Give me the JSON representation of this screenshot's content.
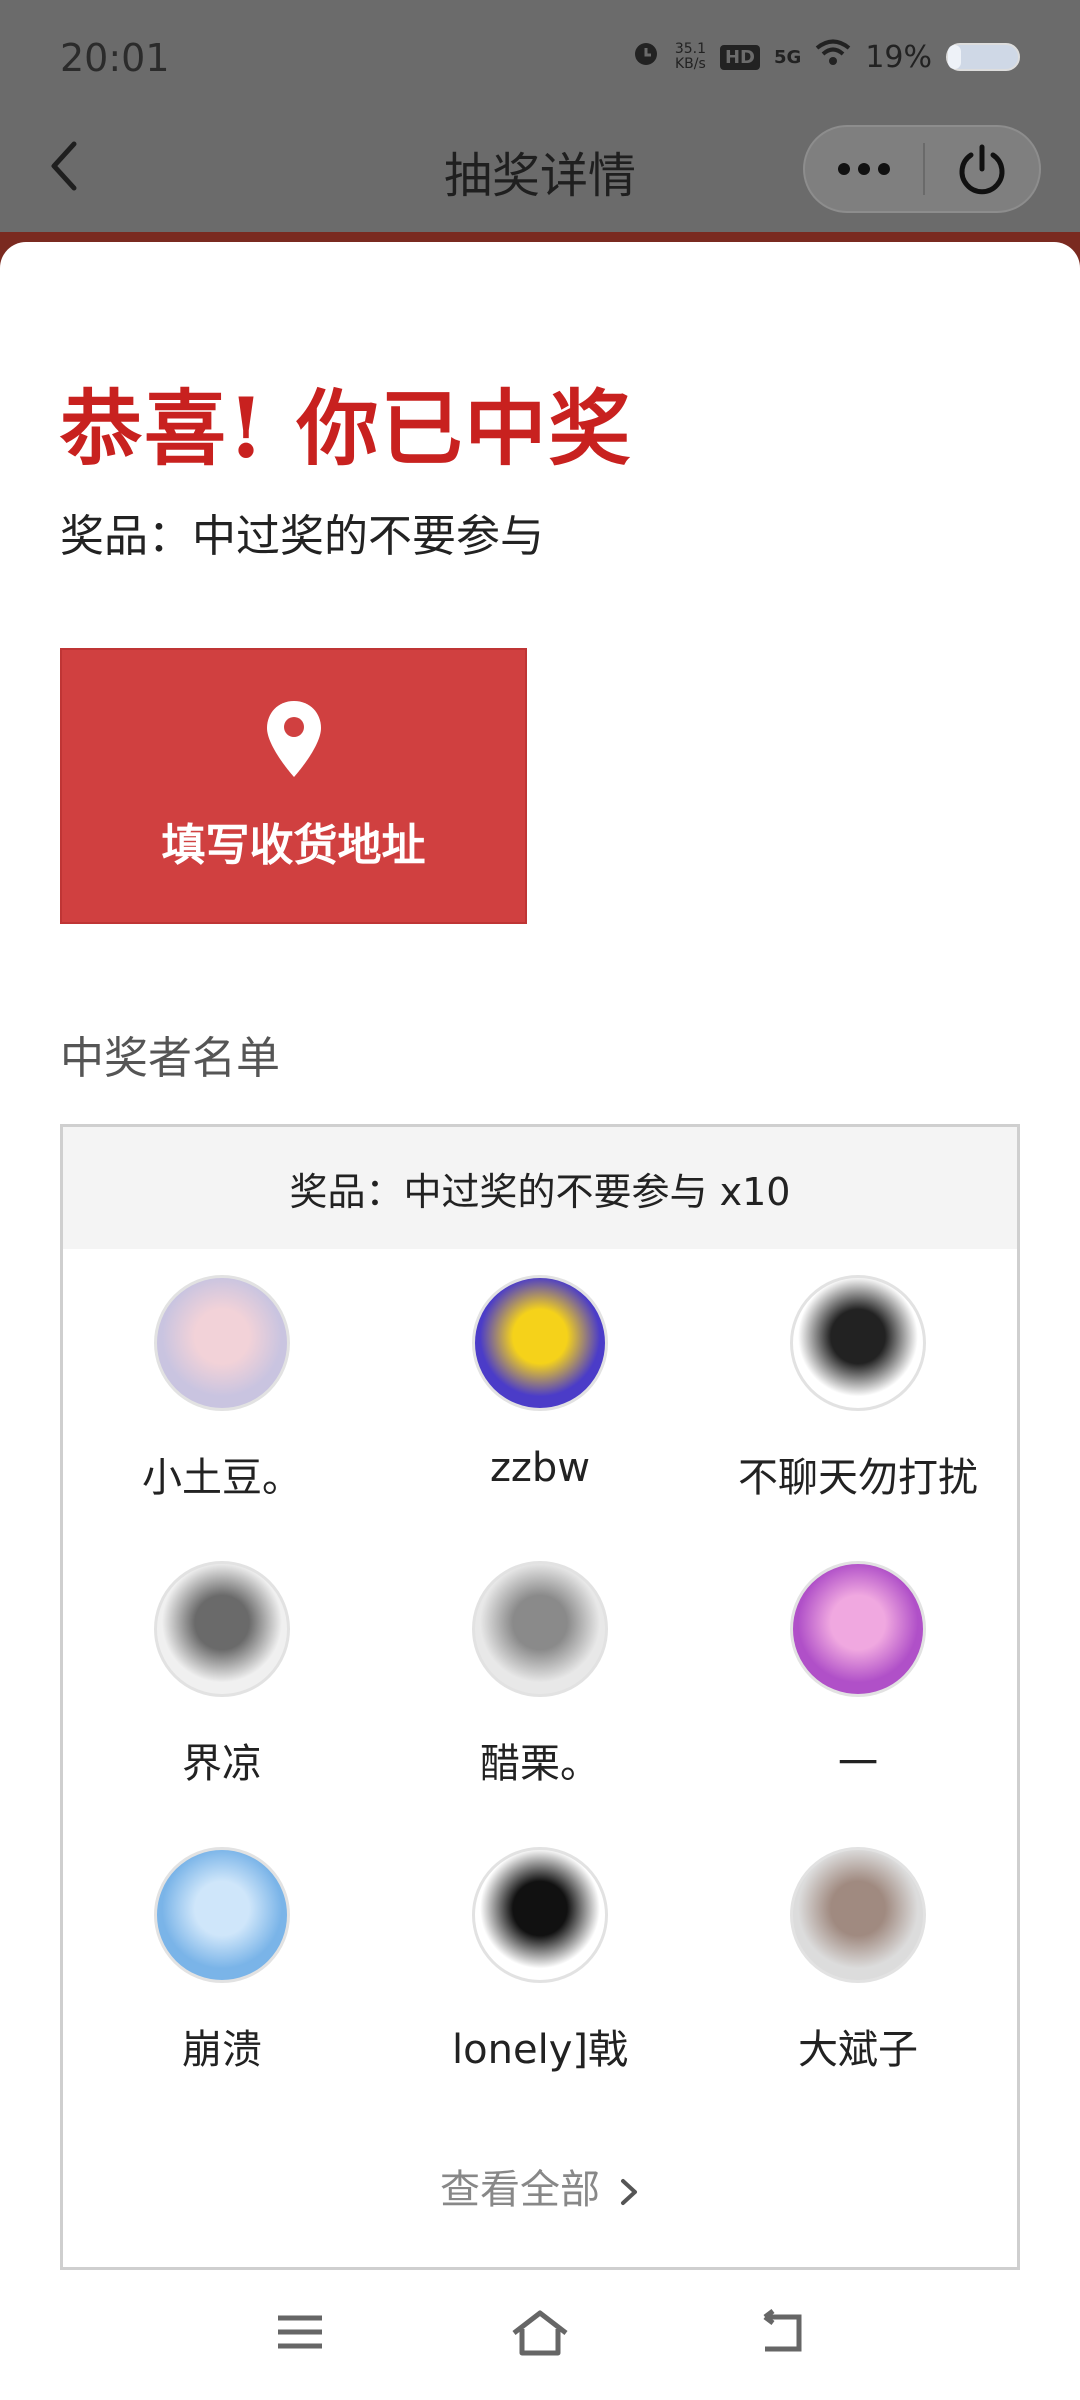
{
  "status_bar": {
    "time": "20:01",
    "net_speed_value": "35.1",
    "net_speed_unit": "KB/s",
    "hd_label": "HD",
    "signal_label": "5G",
    "battery_percent": "19%",
    "battery_level": 0.19,
    "icons": [
      "alarm-icon",
      "hd-icon",
      "signal-5g-icon",
      "wifi-icon",
      "battery-icon"
    ]
  },
  "nav": {
    "title": "抽奖详情",
    "back_icon": "chevron-left-icon",
    "more_icon": "more-dots-icon",
    "close_icon": "power-icon"
  },
  "result": {
    "headline": "恭喜! 你已中奖",
    "prize_line": "奖品：中过奖的不要参与"
  },
  "address_button": {
    "label": "填写收货地址",
    "icon": "location-pin-icon"
  },
  "winners": {
    "section_title": "中奖者名单",
    "box_header": "奖品：中过奖的不要参与 x10",
    "users": [
      {
        "name": "小土豆。",
        "avatar_colors": [
          "#c9c4e0",
          "#f2d2d8"
        ]
      },
      {
        "name": "zzbw",
        "avatar_colors": [
          "#4b3cc8",
          "#f5d21a"
        ]
      },
      {
        "name": "不聊天勿打扰",
        "avatar_colors": [
          "#ffffff",
          "#222222"
        ]
      },
      {
        "name": "界凉",
        "avatar_colors": [
          "#f0f0f0",
          "#6a6a6a"
        ]
      },
      {
        "name": "醋栗。",
        "avatar_colors": [
          "#e8e8e8",
          "#8a8a8a"
        ]
      },
      {
        "name": "一",
        "avatar_colors": [
          "#b050c8",
          "#f0a8e0"
        ]
      },
      {
        "name": "崩溃",
        "avatar_colors": [
          "#7ab4e8",
          "#cfe6fa"
        ]
      },
      {
        "name": "lonely]戟",
        "avatar_colors": [
          "#ffffff",
          "#111111"
        ]
      },
      {
        "name": "大斌子",
        "avatar_colors": [
          "#dcdcdc",
          "#a08a80"
        ]
      }
    ],
    "view_all_label": "查看全部"
  },
  "system_nav": {
    "icons": [
      "menu-icon",
      "home-icon",
      "back-icon"
    ]
  },
  "colors": {
    "accent_red": "#c8211f",
    "button_red": "#d04040",
    "overlay_gray": "#6b6b6b"
  }
}
